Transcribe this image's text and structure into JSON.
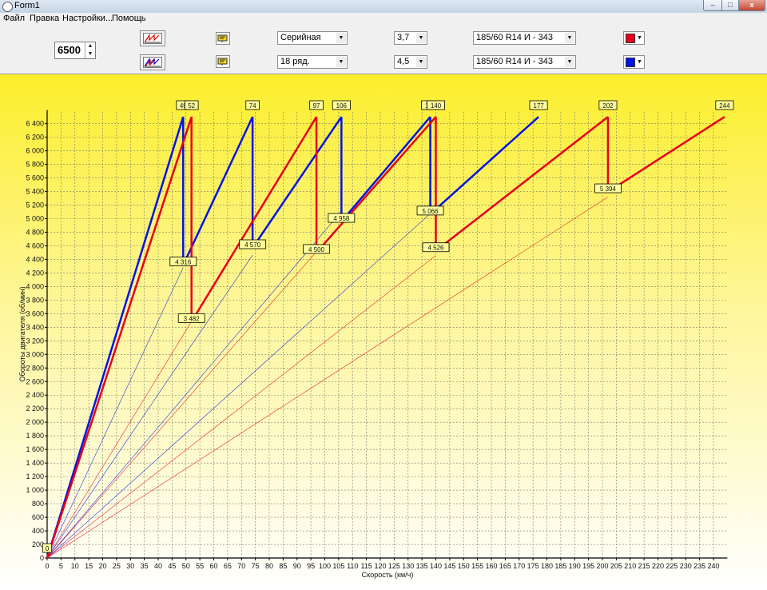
{
  "window": {
    "title": "Form1",
    "min": "–",
    "max": "□",
    "close": "x"
  },
  "menu": [
    "Файл",
    "Правка",
    "Настройки...",
    "Помощь"
  ],
  "toolbar": {
    "rpm_value": "6500",
    "row1": {
      "box": "Серийная",
      "final_drive": "3,7",
      "tire": "185/60  R14  И - 343",
      "color": "#e8001a"
    },
    "row2": {
      "box": "18 ряд.",
      "final_drive": "4,5",
      "tire": "185/60  R14  И - 343",
      "color": "#0014e8"
    }
  },
  "icons": {
    "chart_icon": "chart-icon",
    "settings_icon": "gear-icon"
  },
  "chart_data": {
    "type": "line",
    "ylabel": "Обороты двигателя (об/мин)",
    "xlabel": "Скорость (км/ч)",
    "xlim": [
      0,
      245
    ],
    "ylim": [
      0,
      6600
    ],
    "x_ticks": [
      0,
      5,
      10,
      15,
      20,
      25,
      30,
      35,
      40,
      45,
      50,
      55,
      60,
      65,
      70,
      75,
      80,
      85,
      90,
      95,
      100,
      105,
      110,
      115,
      120,
      125,
      130,
      135,
      140,
      145,
      150,
      155,
      160,
      165,
      170,
      175,
      180,
      185,
      190,
      195,
      200,
      205,
      210,
      215,
      220,
      225,
      230,
      235,
      240
    ],
    "y_ticks": [
      0,
      200,
      400,
      600,
      800,
      1000,
      1200,
      1400,
      1600,
      1800,
      2000,
      2200,
      2400,
      2600,
      2800,
      3000,
      3200,
      3400,
      3600,
      3800,
      4000,
      4200,
      4400,
      4600,
      4800,
      5000,
      5200,
      5400,
      5600,
      5800,
      6000,
      6200,
      6400
    ],
    "y_tick_labels": [
      "0",
      "200",
      "400",
      "600",
      "800",
      "1 000",
      "1 200",
      "1 400",
      "1 600",
      "1 800",
      "2 000",
      "2 200",
      "2 400",
      "2 600",
      "2 800",
      "3 000",
      "3 200",
      "3 400",
      "3 600",
      "3 800",
      "4 000",
      "4 200",
      "4 400",
      "4 600",
      "4 800",
      "5 000",
      "5 200",
      "5 400",
      "5 600",
      "5 800",
      "6 000",
      "6 200",
      "6 400"
    ],
    "max_rpm": 6500,
    "origin_label": "0",
    "series": [
      {
        "color": "#0014e8",
        "gear_lines": [
          {
            "from": [
              0,
              0
            ],
            "to": [
              49,
              6500
            ]
          },
          {
            "from": [
              49,
              4316
            ],
            "to": [
              74,
              6500
            ]
          },
          {
            "from": [
              74,
              4570
            ],
            "to": [
              106,
              6500
            ]
          },
          {
            "from": [
              106,
              4958
            ],
            "to": [
              138,
              6500
            ]
          },
          {
            "from": [
              138,
              5066
            ],
            "to": [
              177,
              6500
            ]
          }
        ],
        "shift_drops": [
          {
            "x": 49,
            "from": 6500,
            "to": 4316
          },
          {
            "x": 74,
            "from": 6500,
            "to": 4570
          },
          {
            "x": 106,
            "from": 6500,
            "to": 4958
          },
          {
            "x": 138,
            "from": 6500,
            "to": 5066
          }
        ],
        "speed_labels": [
          "49",
          "74",
          "106",
          "138",
          "177"
        ],
        "speed_values": [
          49,
          74,
          106,
          138,
          177
        ],
        "rpm_labels": [
          {
            "x": 49,
            "y": 4316,
            "text": "4 316"
          },
          {
            "x": 74,
            "y": 4570,
            "text": "4 570"
          },
          {
            "x": 106,
            "y": 4958,
            "text": "4 958"
          },
          {
            "x": 138,
            "y": 5066,
            "text": "5 066"
          }
        ]
      },
      {
        "color": "#e8001a",
        "gear_lines": [
          {
            "from": [
              0,
              0
            ],
            "to": [
              52,
              6500
            ]
          },
          {
            "from": [
              52,
              3482
            ],
            "to": [
              97,
              6500
            ]
          },
          {
            "from": [
              97,
              4500
            ],
            "to": [
              140,
              6500
            ]
          },
          {
            "from": [
              140,
              4526
            ],
            "to": [
              202,
              6500
            ]
          },
          {
            "from": [
              202,
              5394
            ],
            "to": [
              244,
              6500
            ]
          }
        ],
        "shift_drops": [
          {
            "x": 52,
            "from": 6500,
            "to": 3482
          },
          {
            "x": 97,
            "from": 6500,
            "to": 4500
          },
          {
            "x": 140,
            "from": 6500,
            "to": 4526
          },
          {
            "x": 202,
            "from": 6500,
            "to": 5394
          }
        ],
        "speed_labels": [
          "52",
          "97",
          "140",
          "202",
          "244"
        ],
        "speed_values": [
          52,
          97,
          140,
          202,
          244
        ],
        "rpm_labels": [
          {
            "x": 52,
            "y": 3482,
            "text": "3 482"
          },
          {
            "x": 97,
            "y": 4500,
            "text": "4 500"
          },
          {
            "x": 140,
            "y": 4526,
            "text": "4 526"
          },
          {
            "x": 202,
            "y": 5394,
            "text": "5 394"
          }
        ]
      }
    ]
  }
}
